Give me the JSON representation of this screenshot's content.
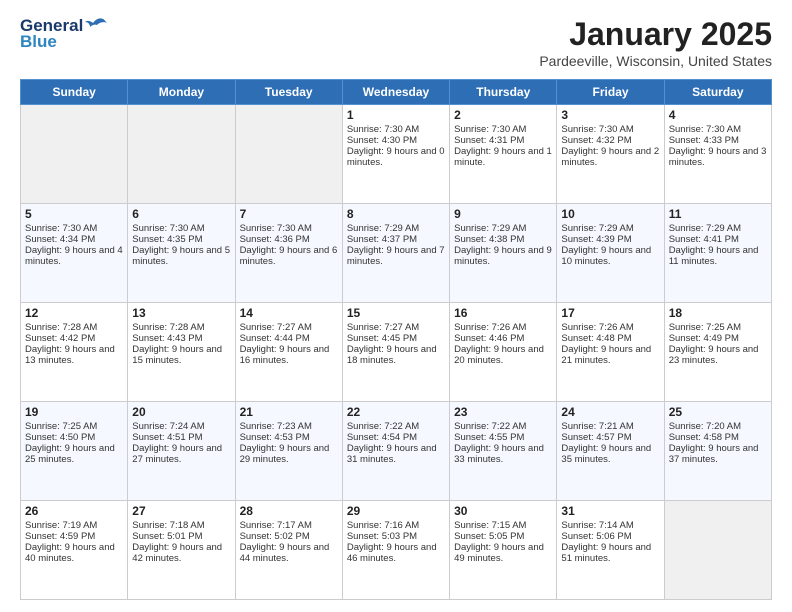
{
  "header": {
    "logo_general": "General",
    "logo_blue": "Blue",
    "month_year": "January 2025",
    "location": "Pardeeville, Wisconsin, United States"
  },
  "weekdays": [
    "Sunday",
    "Monday",
    "Tuesday",
    "Wednesday",
    "Thursday",
    "Friday",
    "Saturday"
  ],
  "weeks": [
    [
      {
        "day": "",
        "sunrise": "",
        "sunset": "",
        "daylight": "",
        "empty": true
      },
      {
        "day": "",
        "sunrise": "",
        "sunset": "",
        "daylight": "",
        "empty": true
      },
      {
        "day": "",
        "sunrise": "",
        "sunset": "",
        "daylight": "",
        "empty": true
      },
      {
        "day": "1",
        "sunrise": "Sunrise: 7:30 AM",
        "sunset": "Sunset: 4:30 PM",
        "daylight": "Daylight: 9 hours and 0 minutes."
      },
      {
        "day": "2",
        "sunrise": "Sunrise: 7:30 AM",
        "sunset": "Sunset: 4:31 PM",
        "daylight": "Daylight: 9 hours and 1 minute."
      },
      {
        "day": "3",
        "sunrise": "Sunrise: 7:30 AM",
        "sunset": "Sunset: 4:32 PM",
        "daylight": "Daylight: 9 hours and 2 minutes."
      },
      {
        "day": "4",
        "sunrise": "Sunrise: 7:30 AM",
        "sunset": "Sunset: 4:33 PM",
        "daylight": "Daylight: 9 hours and 3 minutes."
      }
    ],
    [
      {
        "day": "5",
        "sunrise": "Sunrise: 7:30 AM",
        "sunset": "Sunset: 4:34 PM",
        "daylight": "Daylight: 9 hours and 4 minutes."
      },
      {
        "day": "6",
        "sunrise": "Sunrise: 7:30 AM",
        "sunset": "Sunset: 4:35 PM",
        "daylight": "Daylight: 9 hours and 5 minutes."
      },
      {
        "day": "7",
        "sunrise": "Sunrise: 7:30 AM",
        "sunset": "Sunset: 4:36 PM",
        "daylight": "Daylight: 9 hours and 6 minutes."
      },
      {
        "day": "8",
        "sunrise": "Sunrise: 7:29 AM",
        "sunset": "Sunset: 4:37 PM",
        "daylight": "Daylight: 9 hours and 7 minutes."
      },
      {
        "day": "9",
        "sunrise": "Sunrise: 7:29 AM",
        "sunset": "Sunset: 4:38 PM",
        "daylight": "Daylight: 9 hours and 9 minutes."
      },
      {
        "day": "10",
        "sunrise": "Sunrise: 7:29 AM",
        "sunset": "Sunset: 4:39 PM",
        "daylight": "Daylight: 9 hours and 10 minutes."
      },
      {
        "day": "11",
        "sunrise": "Sunrise: 7:29 AM",
        "sunset": "Sunset: 4:41 PM",
        "daylight": "Daylight: 9 hours and 11 minutes."
      }
    ],
    [
      {
        "day": "12",
        "sunrise": "Sunrise: 7:28 AM",
        "sunset": "Sunset: 4:42 PM",
        "daylight": "Daylight: 9 hours and 13 minutes."
      },
      {
        "day": "13",
        "sunrise": "Sunrise: 7:28 AM",
        "sunset": "Sunset: 4:43 PM",
        "daylight": "Daylight: 9 hours and 15 minutes."
      },
      {
        "day": "14",
        "sunrise": "Sunrise: 7:27 AM",
        "sunset": "Sunset: 4:44 PM",
        "daylight": "Daylight: 9 hours and 16 minutes."
      },
      {
        "day": "15",
        "sunrise": "Sunrise: 7:27 AM",
        "sunset": "Sunset: 4:45 PM",
        "daylight": "Daylight: 9 hours and 18 minutes."
      },
      {
        "day": "16",
        "sunrise": "Sunrise: 7:26 AM",
        "sunset": "Sunset: 4:46 PM",
        "daylight": "Daylight: 9 hours and 20 minutes."
      },
      {
        "day": "17",
        "sunrise": "Sunrise: 7:26 AM",
        "sunset": "Sunset: 4:48 PM",
        "daylight": "Daylight: 9 hours and 21 minutes."
      },
      {
        "day": "18",
        "sunrise": "Sunrise: 7:25 AM",
        "sunset": "Sunset: 4:49 PM",
        "daylight": "Daylight: 9 hours and 23 minutes."
      }
    ],
    [
      {
        "day": "19",
        "sunrise": "Sunrise: 7:25 AM",
        "sunset": "Sunset: 4:50 PM",
        "daylight": "Daylight: 9 hours and 25 minutes."
      },
      {
        "day": "20",
        "sunrise": "Sunrise: 7:24 AM",
        "sunset": "Sunset: 4:51 PM",
        "daylight": "Daylight: 9 hours and 27 minutes."
      },
      {
        "day": "21",
        "sunrise": "Sunrise: 7:23 AM",
        "sunset": "Sunset: 4:53 PM",
        "daylight": "Daylight: 9 hours and 29 minutes."
      },
      {
        "day": "22",
        "sunrise": "Sunrise: 7:22 AM",
        "sunset": "Sunset: 4:54 PM",
        "daylight": "Daylight: 9 hours and 31 minutes."
      },
      {
        "day": "23",
        "sunrise": "Sunrise: 7:22 AM",
        "sunset": "Sunset: 4:55 PM",
        "daylight": "Daylight: 9 hours and 33 minutes."
      },
      {
        "day": "24",
        "sunrise": "Sunrise: 7:21 AM",
        "sunset": "Sunset: 4:57 PM",
        "daylight": "Daylight: 9 hours and 35 minutes."
      },
      {
        "day": "25",
        "sunrise": "Sunrise: 7:20 AM",
        "sunset": "Sunset: 4:58 PM",
        "daylight": "Daylight: 9 hours and 37 minutes."
      }
    ],
    [
      {
        "day": "26",
        "sunrise": "Sunrise: 7:19 AM",
        "sunset": "Sunset: 4:59 PM",
        "daylight": "Daylight: 9 hours and 40 minutes."
      },
      {
        "day": "27",
        "sunrise": "Sunrise: 7:18 AM",
        "sunset": "Sunset: 5:01 PM",
        "daylight": "Daylight: 9 hours and 42 minutes."
      },
      {
        "day": "28",
        "sunrise": "Sunrise: 7:17 AM",
        "sunset": "Sunset: 5:02 PM",
        "daylight": "Daylight: 9 hours and 44 minutes."
      },
      {
        "day": "29",
        "sunrise": "Sunrise: 7:16 AM",
        "sunset": "Sunset: 5:03 PM",
        "daylight": "Daylight: 9 hours and 46 minutes."
      },
      {
        "day": "30",
        "sunrise": "Sunrise: 7:15 AM",
        "sunset": "Sunset: 5:05 PM",
        "daylight": "Daylight: 9 hours and 49 minutes."
      },
      {
        "day": "31",
        "sunrise": "Sunrise: 7:14 AM",
        "sunset": "Sunset: 5:06 PM",
        "daylight": "Daylight: 9 hours and 51 minutes."
      },
      {
        "day": "",
        "sunrise": "",
        "sunset": "",
        "daylight": "",
        "empty": true
      }
    ]
  ]
}
